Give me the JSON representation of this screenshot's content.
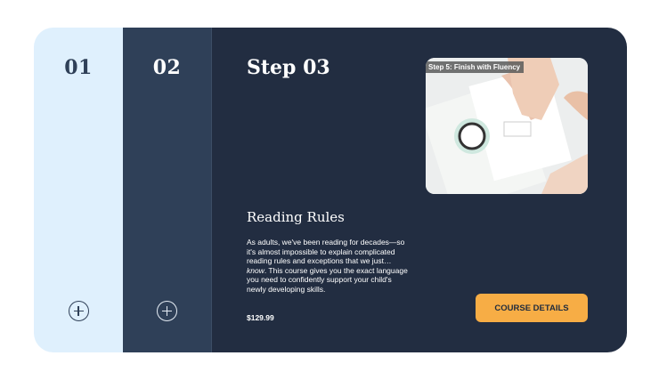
{
  "steps": [
    {
      "number": "01"
    },
    {
      "number": "02"
    }
  ],
  "active_step": {
    "title": "Step 03",
    "image_caption": "Step 5: Finish with Fluency",
    "course_title": "Reading Rules",
    "description_part1": "As adults, we've been reading for decades—so it's almost impossible to explain complicated reading rules and exceptions that we just… ",
    "description_emphasis": "know",
    "description_part2": ". This course gives you the exact language you need to confidently support your child's newly developing skills.",
    "price": "$129.99",
    "button_label": "COURSE DETAILS"
  },
  "colors": {
    "step1_bg": "#dff0fd",
    "step2_bg": "#2f4058",
    "panel_bg": "#222d41",
    "accent": "#f7ad45"
  },
  "icons": {
    "expand": "plus-circle-icon"
  }
}
